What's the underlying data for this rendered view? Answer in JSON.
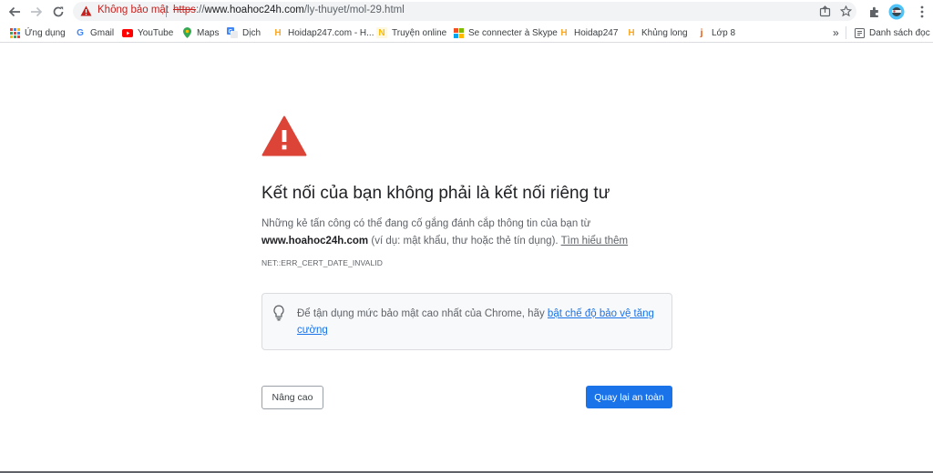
{
  "toolbar": {
    "security_status": "Không bảo mật",
    "url": {
      "scheme": "https",
      "rest": "://",
      "host": "www.hoahoc24h.com",
      "path": "/ly-thuyet/mol-29.html"
    }
  },
  "bookmarks": {
    "items": [
      {
        "label": "Ứng dụng",
        "icon": "apps-grid-icon"
      },
      {
        "label": "Gmail",
        "icon": "google-icon"
      },
      {
        "label": "YouTube",
        "icon": "youtube-icon"
      },
      {
        "label": "Maps",
        "icon": "maps-pin-icon"
      },
      {
        "label": "Dịch",
        "icon": "translate-icon"
      },
      {
        "label": "Hoidap247.com - H...",
        "icon": "hoidap-icon"
      },
      {
        "label": "Truyện online",
        "icon": "truyen-icon"
      },
      {
        "label": "Se connecter à Skype",
        "icon": "microsoft-icon"
      },
      {
        "label": "Hoidap247",
        "icon": "hoidap-icon"
      },
      {
        "label": "Khủng long",
        "icon": "hoidap-icon"
      },
      {
        "label": "Lớp 8",
        "icon": "j-icon"
      }
    ],
    "overflow": "»",
    "reading_list": "Danh sách đọc"
  },
  "interstitial": {
    "heading": "Kết nối của bạn không phải là kết nối riêng tư",
    "desc_part1": "Những kẻ tấn công có thể đang cố gắng đánh cắp thông tin của bạn từ",
    "desc_host": "www.hoahoc24h.com",
    "desc_part2": "(ví dụ: mật khẩu, thư hoặc thẻ tín dụng).",
    "learn_more": "Tìm hiểu thêm",
    "error_code": "NET::ERR_CERT_DATE_INVALID",
    "info_text": "Để tận dụng mức bảo mật cao nhất của Chrome, hãy",
    "info_link": "bật chế độ bảo vệ tăng cường",
    "advanced_button": "Nâng cao",
    "back_button": "Quay lại an toàn"
  },
  "colors": {
    "warning_red": "#db4437",
    "primary_blue": "#1a73e8",
    "link_blue": "#1a73e8"
  }
}
